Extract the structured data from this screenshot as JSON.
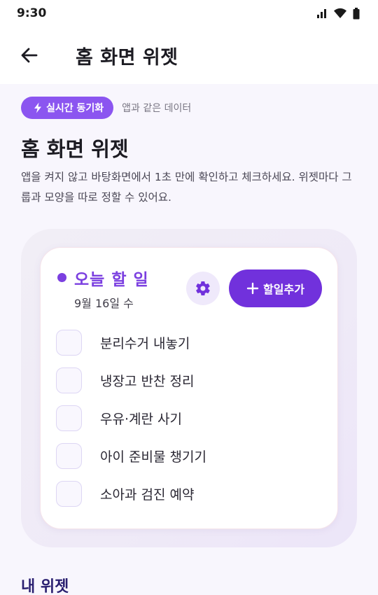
{
  "status": {
    "time": "9:30"
  },
  "app_bar": {
    "title": "홈 화면 위젯"
  },
  "sync": {
    "badge_label": "실시간 동기화",
    "note": "앱과 같은 데이터"
  },
  "section": {
    "title": "홈 화면 위젯",
    "description": "앱을 켜지 않고 바탕화면에서 1초 만에 확인하고 체크하세요. 위젯마다 그룹과 모양을 따로 정할 수 있어요."
  },
  "widget": {
    "title": "오늘 할 일",
    "date": "9월 16일 수",
    "add_label": "할일추가",
    "accent_color": "#7131dc",
    "tasks": [
      {
        "label": "분리수거 내놓기",
        "checked": false
      },
      {
        "label": "냉장고 반찬 정리",
        "checked": false
      },
      {
        "label": "우유·계란 사기",
        "checked": false
      },
      {
        "label": "아이 준비물 챙기기",
        "checked": false
      },
      {
        "label": "소아과 검진 예약",
        "checked": false
      }
    ]
  },
  "my_widgets": {
    "title": "내 위젯"
  },
  "icons": {
    "back": "arrow-left-icon",
    "sync": "lightning-icon",
    "settings": "gear-icon",
    "add": "plus-icon",
    "signal": "signal-icon",
    "wifi": "wifi-icon",
    "battery": "battery-icon"
  }
}
